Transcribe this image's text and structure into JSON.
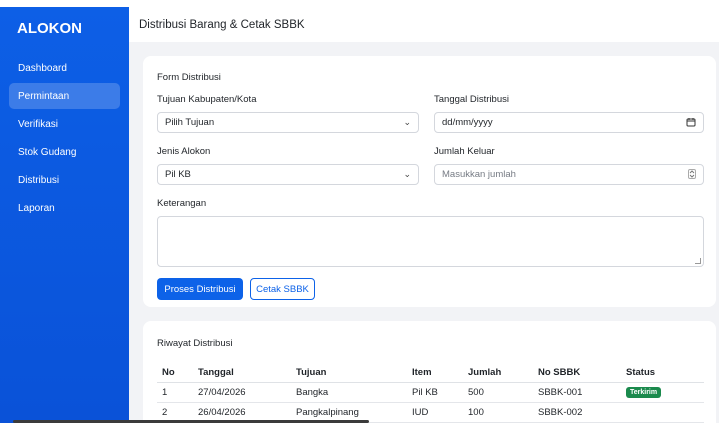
{
  "sidebar": {
    "brand": "ALOKON",
    "items": [
      {
        "label": "Dashboard",
        "active": false
      },
      {
        "label": "Permintaan",
        "active": true
      },
      {
        "label": "Verifikasi",
        "active": false
      },
      {
        "label": "Stok Gudang",
        "active": false
      },
      {
        "label": "Distribusi",
        "active": false
      },
      {
        "label": "Laporan",
        "active": false
      }
    ]
  },
  "header": {
    "title": "Distribusi Barang & Cetak SBBK"
  },
  "form": {
    "title": "Form Distribusi",
    "tujuan_label": "Tujuan Kabupaten/Kota",
    "tujuan_value": "Pilih Tujuan",
    "tanggal_label": "Tanggal Distribusi",
    "tanggal_placeholder": "dd/mm/yyyy",
    "jenis_label": "Jenis Alokon",
    "jenis_value": "Pil KB",
    "jumlah_label": "Jumlah Keluar",
    "jumlah_placeholder": "Masukkan jumlah",
    "keterangan_label": "Keterangan",
    "keterangan_value": "",
    "submit_label": "Proses Distribusi",
    "print_label": "Cetak SBBK"
  },
  "riwayat": {
    "title": "Riwayat Distribusi",
    "columns": [
      "No",
      "Tanggal",
      "Tujuan",
      "Item",
      "Jumlah",
      "No SBBK",
      "Status"
    ],
    "rows": [
      {
        "no": "1",
        "tanggal": "27/04/2026",
        "tujuan": "Bangka",
        "item": "Pil KB",
        "jumlah": "500",
        "sbbk": "SBBK-001",
        "status": "Terkirim"
      },
      {
        "no": "2",
        "tanggal": "26/04/2026",
        "tujuan": "Pangkalpinang",
        "item": "IUD",
        "jumlah": "100",
        "sbbk": "SBBK-002",
        "status": ""
      }
    ]
  },
  "colors": {
    "primary": "#0d62e8",
    "sidebar": "#0a52d8",
    "success": "#1b8a4d",
    "background": "#f2f3f6"
  }
}
